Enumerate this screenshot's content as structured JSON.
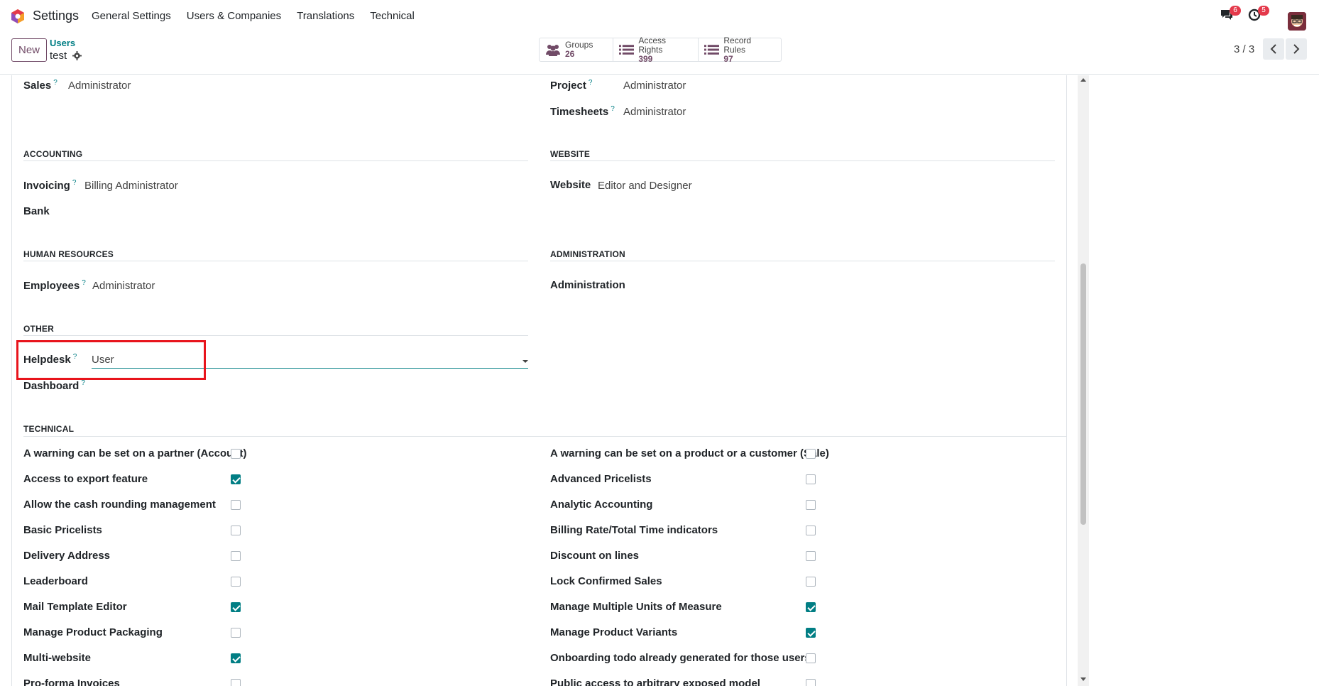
{
  "navbar": {
    "app_name": "Settings",
    "menu": [
      "General Settings",
      "Users & Companies",
      "Translations",
      "Technical"
    ],
    "messages_badge": "6",
    "activities_badge": "5"
  },
  "control_panel": {
    "new_label": "New",
    "breadcrumb_parent": "Users",
    "breadcrumb_current": "test",
    "smart_buttons": [
      {
        "label": "Groups",
        "count": "26",
        "icon": "users-icon"
      },
      {
        "label": "Access Rights",
        "count": "399",
        "icon": "list-icon"
      },
      {
        "label": "Record Rules",
        "count": "97",
        "icon": "list-icon"
      }
    ],
    "pager": "3 / 3"
  },
  "form": {
    "sales": {
      "label": "Sales",
      "help": "?",
      "value": "Administrator"
    },
    "project": {
      "label": "Project",
      "help": "?",
      "value": "Administrator"
    },
    "timesheets": {
      "label": "Timesheets",
      "help": "?",
      "value": "Administrator"
    },
    "accounting_title": "ACCOUNTING",
    "website_title": "WEBSITE",
    "invoicing": {
      "label": "Invoicing",
      "help": "?",
      "value": "Billing Administrator"
    },
    "bank": {
      "label": "Bank"
    },
    "website": {
      "label": "Website",
      "value": "Editor and Designer"
    },
    "hr_title": "HUMAN RESOURCES",
    "admin_title": "ADMINISTRATION",
    "employees": {
      "label": "Employees",
      "help": "?",
      "value": "Administrator"
    },
    "administration": {
      "label": "Administration"
    },
    "other_title": "OTHER",
    "helpdesk": {
      "label": "Helpdesk",
      "help": "?",
      "value": "User"
    },
    "dashboard": {
      "label": "Dashboard",
      "help": "?"
    },
    "technical_title": "TECHNICAL",
    "technical_left": [
      {
        "label": "A warning can be set on a partner (Account)",
        "checked": false
      },
      {
        "label": "Access to export feature",
        "checked": true
      },
      {
        "label": "Allow the cash rounding management",
        "checked": false
      },
      {
        "label": "Basic Pricelists",
        "checked": false
      },
      {
        "label": "Delivery Address",
        "checked": false
      },
      {
        "label": "Leaderboard",
        "checked": false
      },
      {
        "label": "Mail Template Editor",
        "checked": true
      },
      {
        "label": "Manage Product Packaging",
        "checked": false
      },
      {
        "label": "Multi-website",
        "checked": true
      },
      {
        "label": "Pro-forma Invoices",
        "checked": false
      }
    ],
    "technical_right": [
      {
        "label": "A warning can be set on a product or a customer (Sale)",
        "checked": false
      },
      {
        "label": "Advanced Pricelists",
        "checked": false
      },
      {
        "label": "Analytic Accounting",
        "checked": false
      },
      {
        "label": "Billing Rate/Total Time indicators",
        "checked": false
      },
      {
        "label": "Discount on lines",
        "checked": false
      },
      {
        "label": "Lock Confirmed Sales",
        "checked": false
      },
      {
        "label": "Manage Multiple Units of Measure",
        "checked": true
      },
      {
        "label": "Manage Product Variants",
        "checked": true
      },
      {
        "label": "Onboarding todo already generated for those users",
        "checked": false
      },
      {
        "label": "Public access to arbitrary exposed model",
        "checked": false
      }
    ]
  },
  "colors": {
    "brand": "#714b67",
    "accent": "#017e84",
    "highlight": "#e8141c",
    "badge": "#e4394b"
  }
}
